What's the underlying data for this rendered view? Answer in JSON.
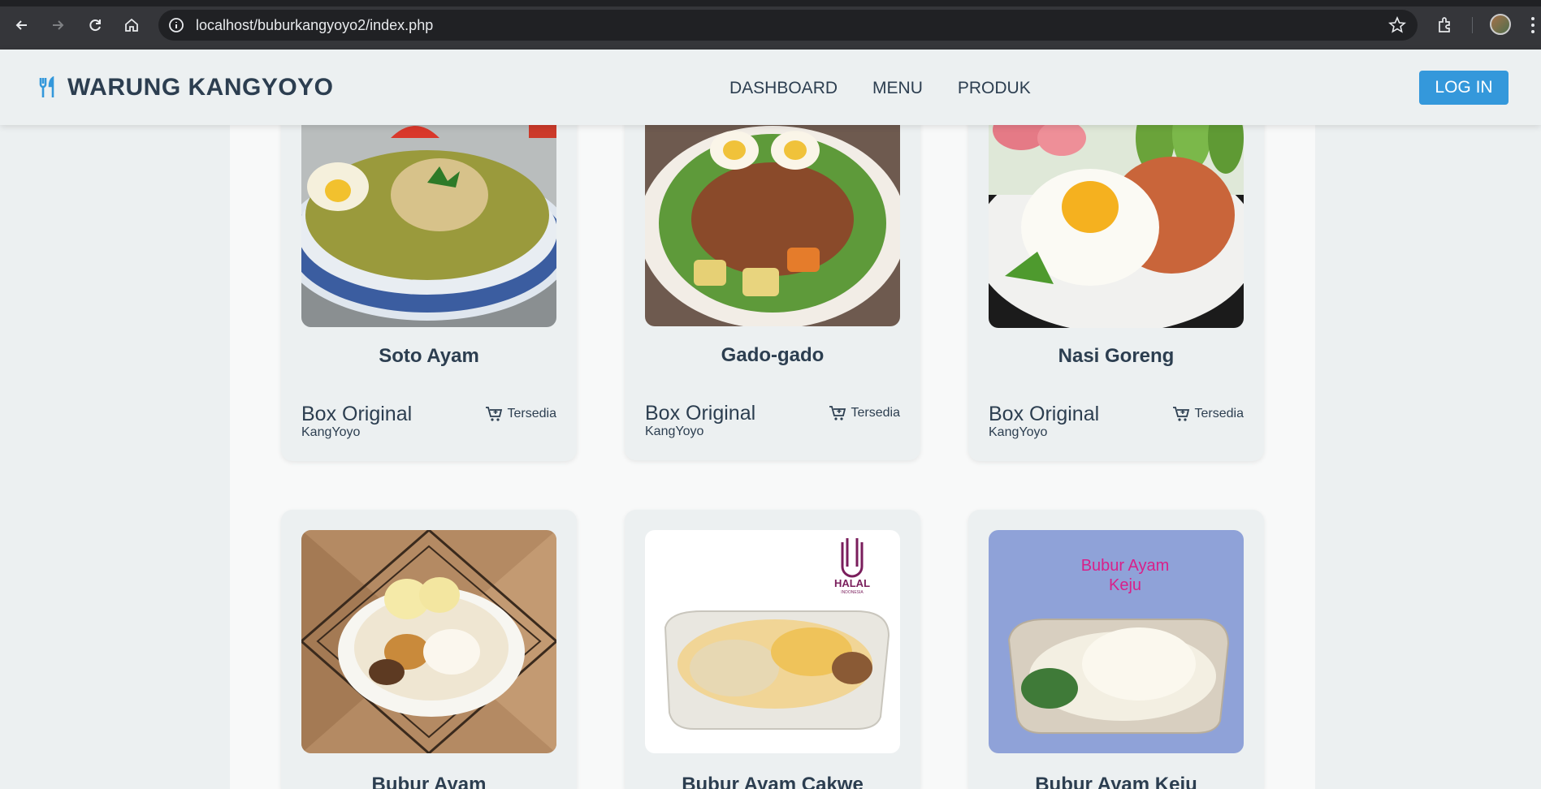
{
  "browser": {
    "url": "localhost/buburkangyoyo2/index.php"
  },
  "header": {
    "brand": "WARUNG KANGYOYO",
    "nav": [
      "DASHBOARD",
      "MENU",
      "PRODUK"
    ],
    "login_label": "LOG IN"
  },
  "products": [
    {
      "name": "Soto Ayam",
      "box": "Box Original",
      "brand": "KangYoyo",
      "status": "Tersedia"
    },
    {
      "name": "Gado-gado",
      "box": "Box Original",
      "brand": "KangYoyo",
      "status": "Tersedia"
    },
    {
      "name": "Nasi Goreng",
      "box": "Box Original",
      "brand": "KangYoyo",
      "status": "Tersedia"
    },
    {
      "name": "Bubur Ayam"
    },
    {
      "name": "Bubur Ayam Cakwe",
      "badge": "HALAL",
      "badge_sub": "INDONESIA"
    },
    {
      "name": "Bubur Ayam Keju",
      "overlay": "Bubur Ayam\nKeju"
    }
  ],
  "colors": {
    "accent": "#3498db",
    "text": "#2c3e50",
    "background": "#ecf0f1"
  }
}
